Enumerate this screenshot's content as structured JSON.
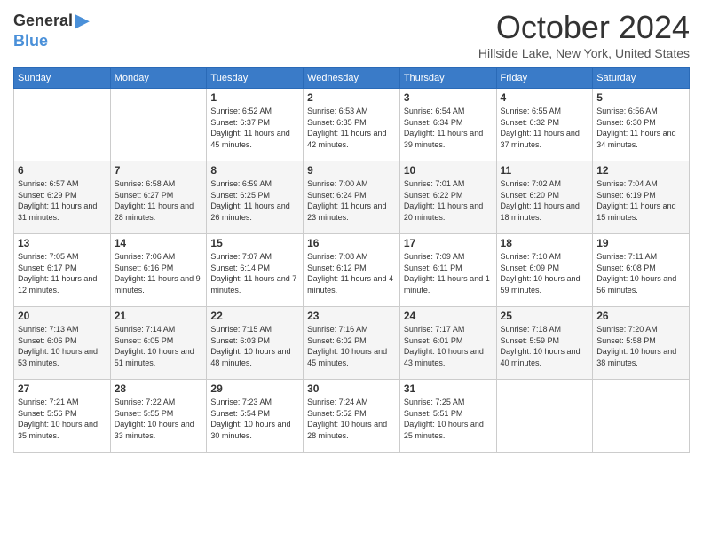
{
  "header": {
    "logo": {
      "general": "General",
      "blue": "Blue",
      "arrow": "▶"
    },
    "title": "October 2024",
    "location": "Hillside Lake, New York, United States"
  },
  "calendar": {
    "days_of_week": [
      "Sunday",
      "Monday",
      "Tuesday",
      "Wednesday",
      "Thursday",
      "Friday",
      "Saturday"
    ],
    "weeks": [
      [
        {
          "day": "",
          "info": ""
        },
        {
          "day": "",
          "info": ""
        },
        {
          "day": "1",
          "info": "Sunrise: 6:52 AM\nSunset: 6:37 PM\nDaylight: 11 hours and 45 minutes."
        },
        {
          "day": "2",
          "info": "Sunrise: 6:53 AM\nSunset: 6:35 PM\nDaylight: 11 hours and 42 minutes."
        },
        {
          "day": "3",
          "info": "Sunrise: 6:54 AM\nSunset: 6:34 PM\nDaylight: 11 hours and 39 minutes."
        },
        {
          "day": "4",
          "info": "Sunrise: 6:55 AM\nSunset: 6:32 PM\nDaylight: 11 hours and 37 minutes."
        },
        {
          "day": "5",
          "info": "Sunrise: 6:56 AM\nSunset: 6:30 PM\nDaylight: 11 hours and 34 minutes."
        }
      ],
      [
        {
          "day": "6",
          "info": "Sunrise: 6:57 AM\nSunset: 6:29 PM\nDaylight: 11 hours and 31 minutes."
        },
        {
          "day": "7",
          "info": "Sunrise: 6:58 AM\nSunset: 6:27 PM\nDaylight: 11 hours and 28 minutes."
        },
        {
          "day": "8",
          "info": "Sunrise: 6:59 AM\nSunset: 6:25 PM\nDaylight: 11 hours and 26 minutes."
        },
        {
          "day": "9",
          "info": "Sunrise: 7:00 AM\nSunset: 6:24 PM\nDaylight: 11 hours and 23 minutes."
        },
        {
          "day": "10",
          "info": "Sunrise: 7:01 AM\nSunset: 6:22 PM\nDaylight: 11 hours and 20 minutes."
        },
        {
          "day": "11",
          "info": "Sunrise: 7:02 AM\nSunset: 6:20 PM\nDaylight: 11 hours and 18 minutes."
        },
        {
          "day": "12",
          "info": "Sunrise: 7:04 AM\nSunset: 6:19 PM\nDaylight: 11 hours and 15 minutes."
        }
      ],
      [
        {
          "day": "13",
          "info": "Sunrise: 7:05 AM\nSunset: 6:17 PM\nDaylight: 11 hours and 12 minutes."
        },
        {
          "day": "14",
          "info": "Sunrise: 7:06 AM\nSunset: 6:16 PM\nDaylight: 11 hours and 9 minutes."
        },
        {
          "day": "15",
          "info": "Sunrise: 7:07 AM\nSunset: 6:14 PM\nDaylight: 11 hours and 7 minutes."
        },
        {
          "day": "16",
          "info": "Sunrise: 7:08 AM\nSunset: 6:12 PM\nDaylight: 11 hours and 4 minutes."
        },
        {
          "day": "17",
          "info": "Sunrise: 7:09 AM\nSunset: 6:11 PM\nDaylight: 11 hours and 1 minute."
        },
        {
          "day": "18",
          "info": "Sunrise: 7:10 AM\nSunset: 6:09 PM\nDaylight: 10 hours and 59 minutes."
        },
        {
          "day": "19",
          "info": "Sunrise: 7:11 AM\nSunset: 6:08 PM\nDaylight: 10 hours and 56 minutes."
        }
      ],
      [
        {
          "day": "20",
          "info": "Sunrise: 7:13 AM\nSunset: 6:06 PM\nDaylight: 10 hours and 53 minutes."
        },
        {
          "day": "21",
          "info": "Sunrise: 7:14 AM\nSunset: 6:05 PM\nDaylight: 10 hours and 51 minutes."
        },
        {
          "day": "22",
          "info": "Sunrise: 7:15 AM\nSunset: 6:03 PM\nDaylight: 10 hours and 48 minutes."
        },
        {
          "day": "23",
          "info": "Sunrise: 7:16 AM\nSunset: 6:02 PM\nDaylight: 10 hours and 45 minutes."
        },
        {
          "day": "24",
          "info": "Sunrise: 7:17 AM\nSunset: 6:01 PM\nDaylight: 10 hours and 43 minutes."
        },
        {
          "day": "25",
          "info": "Sunrise: 7:18 AM\nSunset: 5:59 PM\nDaylight: 10 hours and 40 minutes."
        },
        {
          "day": "26",
          "info": "Sunrise: 7:20 AM\nSunset: 5:58 PM\nDaylight: 10 hours and 38 minutes."
        }
      ],
      [
        {
          "day": "27",
          "info": "Sunrise: 7:21 AM\nSunset: 5:56 PM\nDaylight: 10 hours and 35 minutes."
        },
        {
          "day": "28",
          "info": "Sunrise: 7:22 AM\nSunset: 5:55 PM\nDaylight: 10 hours and 33 minutes."
        },
        {
          "day": "29",
          "info": "Sunrise: 7:23 AM\nSunset: 5:54 PM\nDaylight: 10 hours and 30 minutes."
        },
        {
          "day": "30",
          "info": "Sunrise: 7:24 AM\nSunset: 5:52 PM\nDaylight: 10 hours and 28 minutes."
        },
        {
          "day": "31",
          "info": "Sunrise: 7:25 AM\nSunset: 5:51 PM\nDaylight: 10 hours and 25 minutes."
        },
        {
          "day": "",
          "info": ""
        },
        {
          "day": "",
          "info": ""
        }
      ]
    ]
  }
}
